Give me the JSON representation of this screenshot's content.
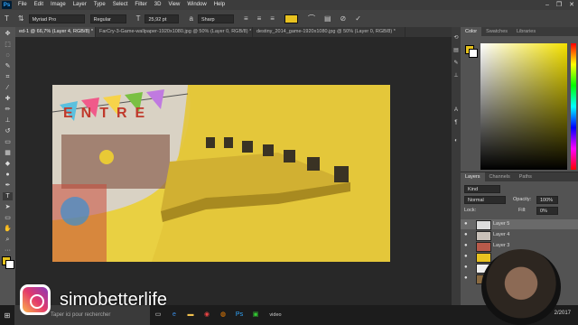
{
  "app": {
    "logo": "Ps"
  },
  "menu": [
    "File",
    "Edit",
    "Image",
    "Layer",
    "Type",
    "Select",
    "Filter",
    "3D",
    "View",
    "Window",
    "Help"
  ],
  "window_controls": [
    "–",
    "❐",
    "✕"
  ],
  "options_bar": {
    "font_family": "Myriad Pro",
    "font_style": "Regular",
    "font_size": "25,92 pt",
    "anti_alias": "Sharp",
    "text_color": "#e8c220"
  },
  "doc_tabs": [
    {
      "label": "ed-1 @ 66,7% (Layer 4, RGB/8) *",
      "active": true
    },
    {
      "label": "FarCry-3-Game-wallpaper-1920x1080.jpg @ 50% (Layer 0, RGB/8) *",
      "active": false
    },
    {
      "label": "destiny_2014_game-1920x1080.jpg @ 50% (Layer 0, RGB/8) *",
      "active": false
    }
  ],
  "canvas": {
    "banner_text": "ENTRE"
  },
  "color_panel": {
    "tabs": [
      "Color",
      "Swatches",
      "Libraries"
    ],
    "foreground": "#e6c21c",
    "background": "#ffffff"
  },
  "layers_panel": {
    "tabs": [
      "Layers",
      "Channels",
      "Paths"
    ],
    "kind_label": "Kind",
    "blend_mode": "Normal",
    "opacity_label": "Opacity:",
    "opacity_value": "100%",
    "lock_label": "Lock:",
    "fill_label": "Fill:",
    "fill_value": "0%",
    "layers": [
      {
        "name": "Layer 5",
        "thumb": "#dddddd"
      },
      {
        "name": "Layer 4",
        "thumb": "#c8c0b8"
      },
      {
        "name": "Layer 3",
        "thumb": "#b85a4a"
      },
      {
        "name": "",
        "thumb": "#e8c220"
      },
      {
        "name": "",
        "thumb": "#f0f0f0"
      },
      {
        "name": "",
        "thumb": "#8a6a40"
      }
    ]
  },
  "taskbar": {
    "search_placeholder": "Taper ici pour rechercher",
    "video_label": "video",
    "clock": "2/2017",
    "icons": [
      "task-view",
      "edge",
      "file-explorer",
      "chrome",
      "firefox",
      "photoshop",
      "camtasia",
      "video"
    ]
  },
  "watermark": {
    "handle": "simobetterlife"
  }
}
